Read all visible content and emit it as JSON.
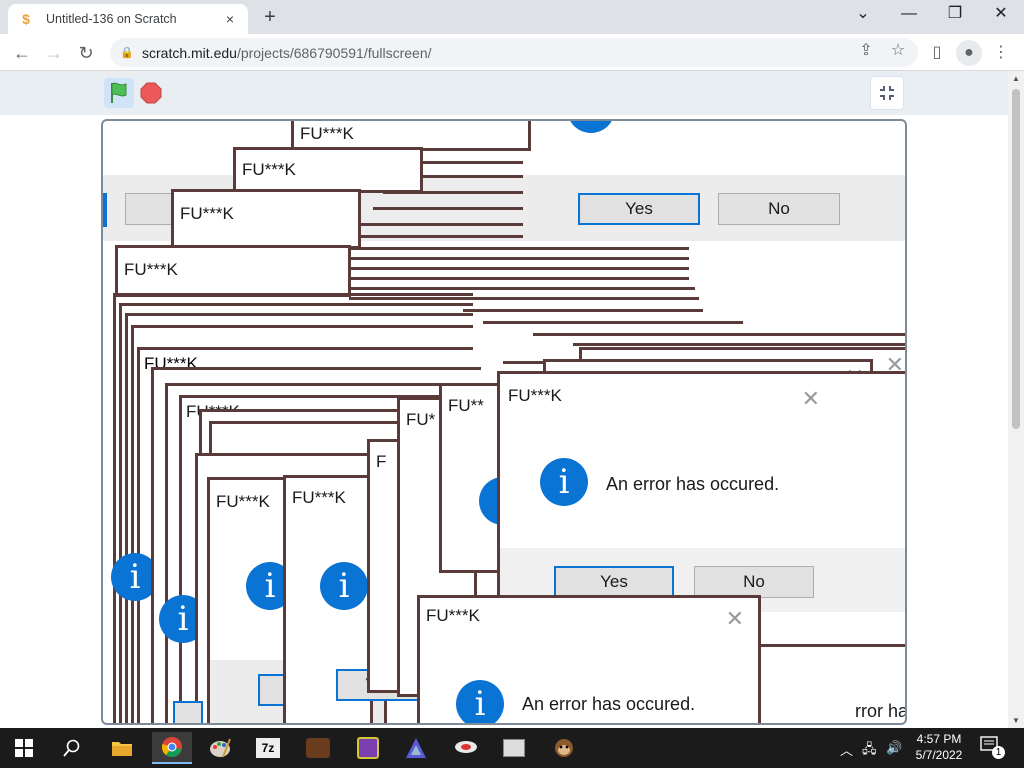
{
  "browser": {
    "tab_title": "Untitled-136 on Scratch",
    "tab_close": "×",
    "new_tab": "+",
    "url_host": "scratch.mit.edu",
    "url_path": "/projects/686790591/fullscreen/",
    "window_controls": {
      "dropdown": "⌄",
      "minimize": "—",
      "restore": "❐",
      "close": "✕"
    }
  },
  "scratch": {
    "green_flag": "green-flag-icon",
    "stop": "stop-icon",
    "unfullscreen": "exit-fullscreen-icon"
  },
  "dialogs": {
    "caption": "FU***K",
    "caption_partial_1": "FU***K",
    "caption_partial_2": "FU*",
    "caption_partial_3": "FU**",
    "caption_partial_4": "F",
    "caption_partial_5": "FU***K",
    "message": "An error has occured.",
    "message_partial": "rror ha",
    "yes": "Yes",
    "no": "No",
    "yes_partial": "Yes",
    "close": "✕",
    "info_glyph": "i"
  },
  "taskbar": {
    "time": "4:57 PM",
    "date": "5/7/2022",
    "notification_count": "1",
    "apps": [
      "windows-start",
      "search",
      "file-explorer",
      "chrome",
      "paint",
      "7zip",
      "coffee-app",
      "paint-app-2",
      "vpn-app",
      "wings-app",
      "window-app",
      "monkey-app"
    ]
  }
}
